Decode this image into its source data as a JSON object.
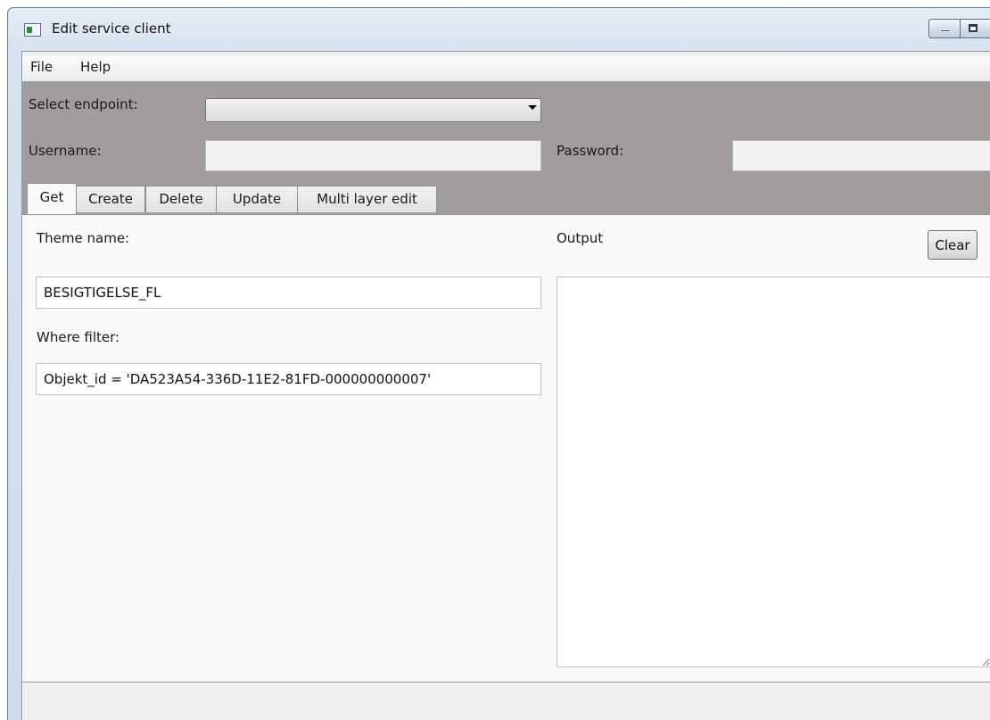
{
  "window": {
    "title": "Edit service client",
    "icon": "app-window-icon",
    "controls": [
      "minimize-icon",
      "maximize-icon"
    ]
  },
  "menu": {
    "items": [
      {
        "label": "File"
      },
      {
        "label": "Help"
      }
    ]
  },
  "connection": {
    "endpoint_label": "Select endpoint:",
    "endpoint_value": "",
    "username_label": "Username:",
    "username_value": "",
    "password_label": "Password:",
    "password_value": ""
  },
  "tabs": [
    {
      "label": "Get",
      "active": true
    },
    {
      "label": "Create",
      "active": false
    },
    {
      "label": "Delete",
      "active": false
    },
    {
      "label": "Update",
      "active": false
    },
    {
      "label": "Multi layer edit",
      "active": false
    }
  ],
  "get_tab": {
    "theme_label": "Theme name:",
    "theme_value": "BESIGTIGELSE_FL",
    "where_label": "Where filter:",
    "where_value": "Objekt_id = 'DA523A54-336D-11E2-81FD-000000000007'"
  },
  "output": {
    "label": "Output",
    "clear_label": "Clear",
    "content": ""
  },
  "colors": {
    "panel_bg": "#a19d9b",
    "client_bg": "#f0f0f0",
    "tab_content_bg": "#f9f9f9"
  }
}
